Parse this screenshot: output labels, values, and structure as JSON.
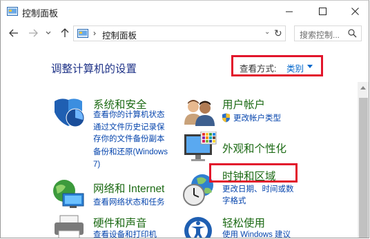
{
  "window": {
    "title": "控制面板"
  },
  "address": {
    "separator": "›",
    "path": "控制面板",
    "search_placeholder": "搜索控制..."
  },
  "main": {
    "heading": "调整计算机的设置",
    "view_by_label": "查看方式:",
    "view_by_value": "类别"
  },
  "categories": [
    {
      "title": "系统和安全",
      "links": [
        "查看你的计算机状态",
        "通过文件历史记录保",
        "存你的文件备份副本",
        "备份和还原(Windows",
        "7)"
      ]
    },
    {
      "title": "网络和 Internet",
      "links": [
        "查看网络状态和任务"
      ]
    },
    {
      "title": "硬件和声音",
      "links": [
        "查看设备和打印机"
      ]
    },
    {
      "title": "用户帐户",
      "links": [
        "更改帐户类型"
      ]
    },
    {
      "title": "外观和个性化",
      "links": []
    },
    {
      "title": "时钟和区域",
      "links": [
        "更改日期、时间或数",
        "字格式"
      ]
    },
    {
      "title": "轻松使用",
      "links": [
        "使用 Windows 建议"
      ]
    }
  ],
  "colors": {
    "heading": "#1e3287",
    "category_title": "#1c6a14",
    "link": "#0645ad",
    "highlight": "#e2152b"
  }
}
